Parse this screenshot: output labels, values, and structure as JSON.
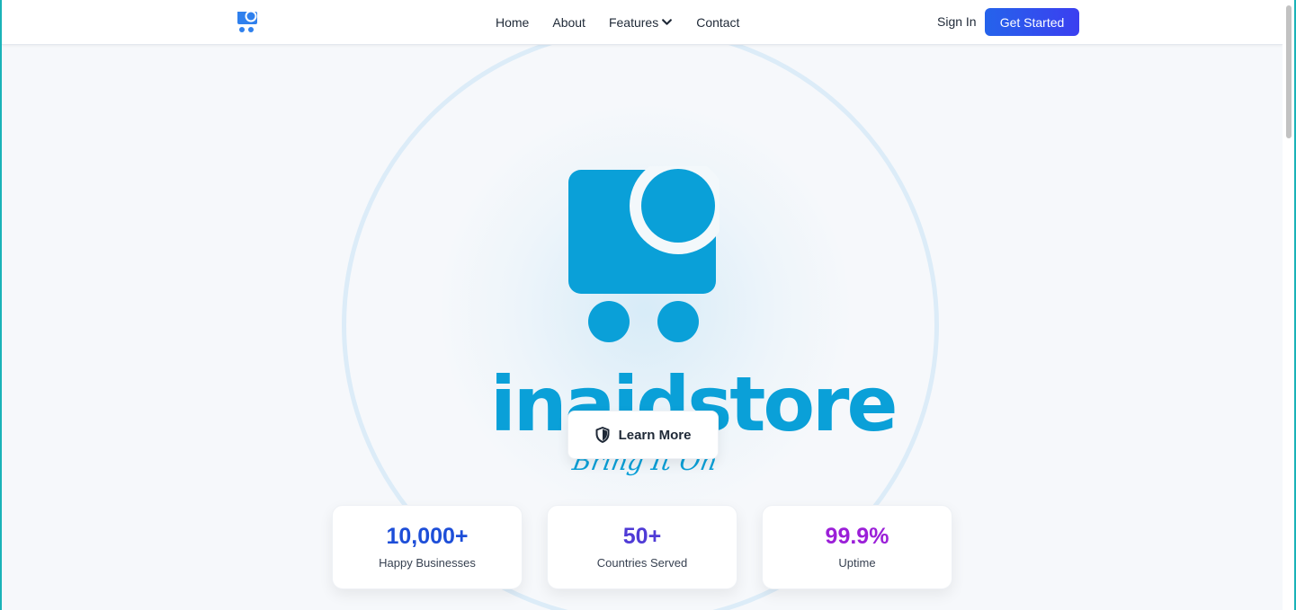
{
  "nav": {
    "logo_icon": "shopping-cart-logo-icon",
    "links": [
      "Home",
      "About",
      "Features",
      "Contact"
    ],
    "features_icon": "chevron-down-icon",
    "signin_label": "Sign In",
    "cta_label": "Get Started"
  },
  "hero": {
    "logo_icon": "shopping-cart-logo-icon",
    "wordmark": "inaidstore",
    "tagline": "Bring It On",
    "learn_more_label": "Learn More",
    "learn_more_icon": "shield-icon"
  },
  "stats": [
    {
      "value": "10,000+",
      "label": "Happy Businesses",
      "color": "#1d4ed8"
    },
    {
      "value": "50+",
      "label": "Countries Served",
      "color": "#4f3bd6"
    },
    {
      "value": "99.9%",
      "label": "Uptime",
      "color": "#9b1fd8"
    }
  ],
  "colors": {
    "brand": "#0aa0d8",
    "cta": "#2563eb",
    "nav_logo": "#2f80ed"
  }
}
